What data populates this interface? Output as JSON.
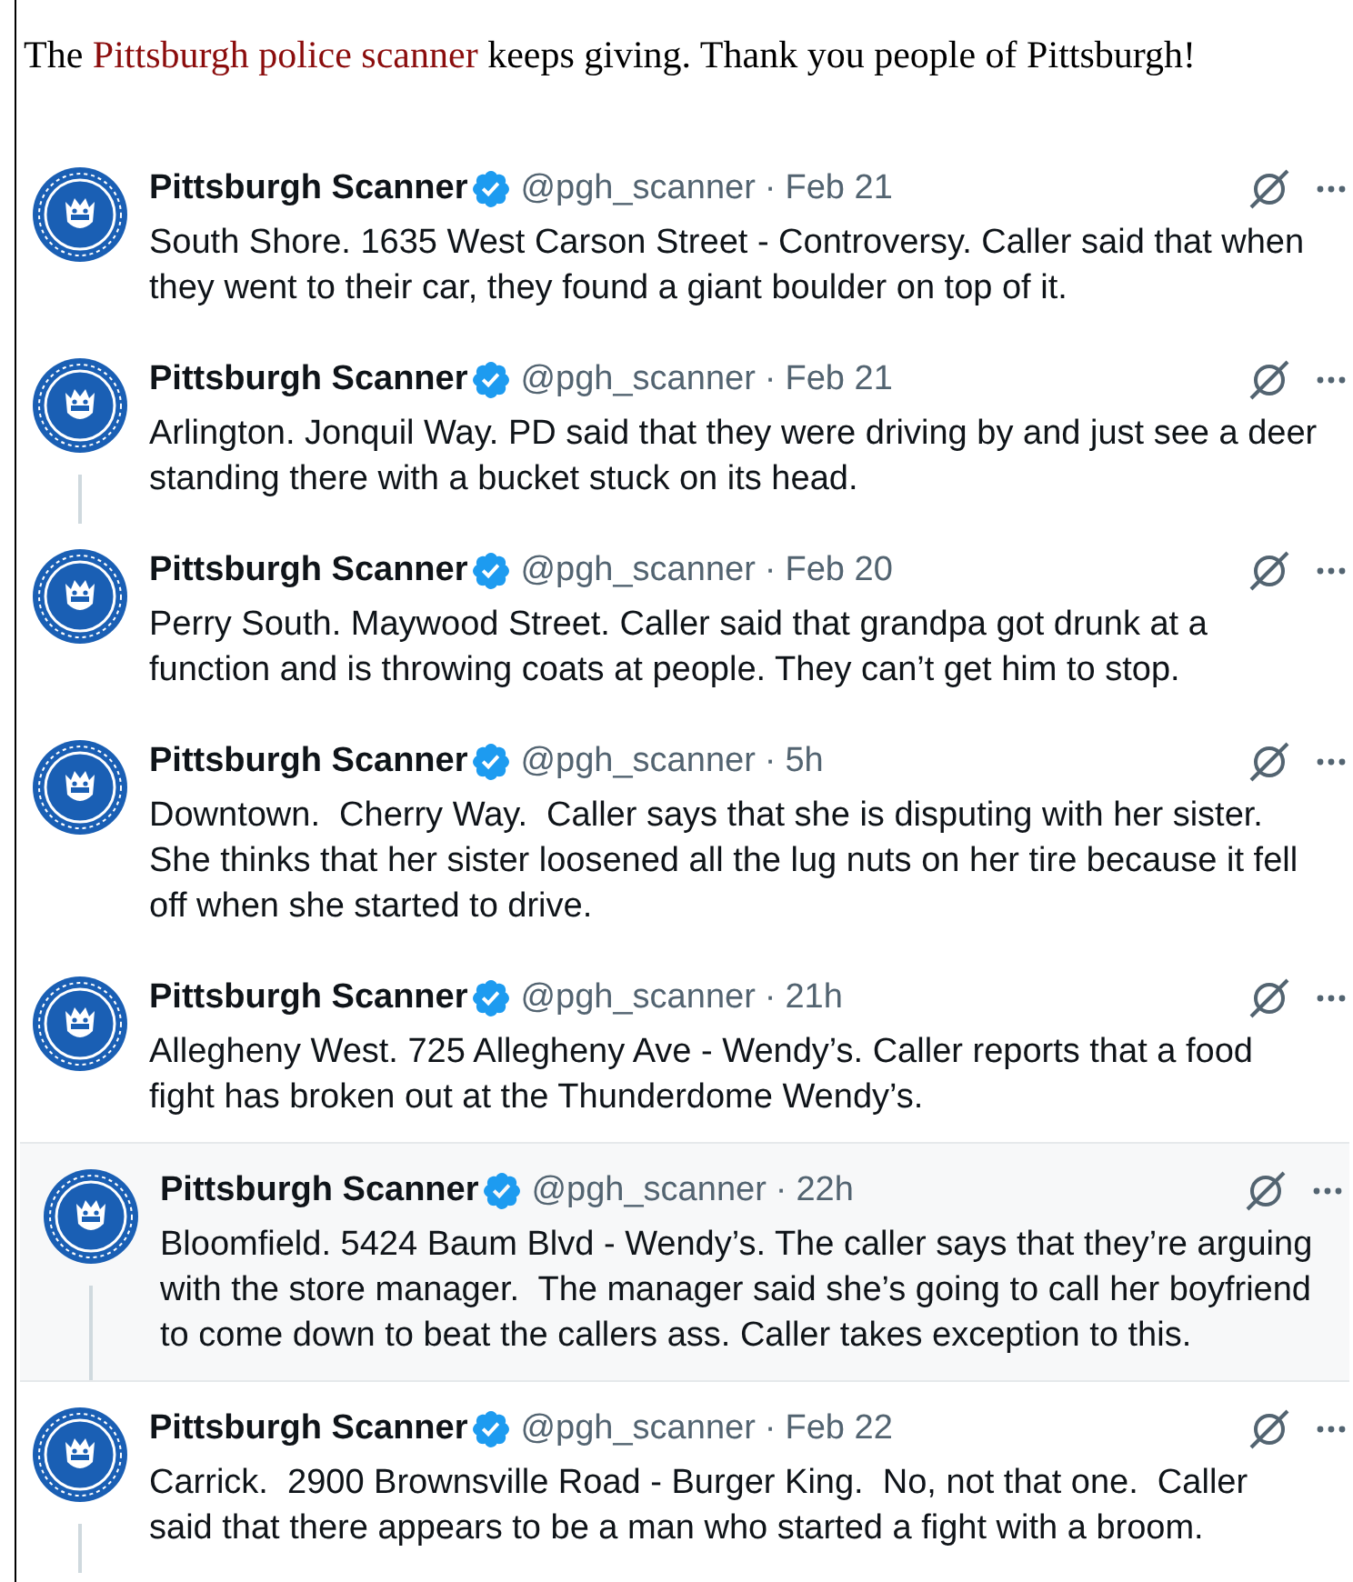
{
  "intro": {
    "text_before": "The ",
    "link": "Pittsburgh police scanner",
    "text_after": " keeps giving. Thank you people of Pittsburgh!"
  },
  "tweets": [
    {
      "name": "Pittsburgh Scanner",
      "verified": true,
      "handle": "@pgh_scanner",
      "separator": "·",
      "time": "Feb 21",
      "text": "South Shore. 1635 West Carson Street - Controversy. Caller said that when\nthey went to their car, they found a giant boulder on top of it.",
      "thread_line": false,
      "highlighted": false
    },
    {
      "name": "Pittsburgh Scanner",
      "verified": true,
      "handle": "@pgh_scanner",
      "separator": "·",
      "time": "Feb 21",
      "text": "Arlington. Jonquil Way. PD said that they were driving by and just see a deer\nstanding there with a bucket stuck on its head.",
      "thread_line": true,
      "highlighted": false
    },
    {
      "name": "Pittsburgh Scanner",
      "verified": true,
      "handle": "@pgh_scanner",
      "separator": "·",
      "time": "Feb 20",
      "text": "Perry South. Maywood Street. Caller said that grandpa got drunk at a\nfunction and is throwing coats at people. They can’t get him to stop.",
      "thread_line": false,
      "highlighted": false
    },
    {
      "name": "Pittsburgh Scanner",
      "verified": true,
      "handle": "@pgh_scanner",
      "separator": "·",
      "time": "5h",
      "text": "Downtown.  Cherry Way.  Caller says that she is disputing with her sister.\nShe thinks that her sister loosened all the lug nuts on her tire because it fell\noff when she started to drive.",
      "thread_line": false,
      "highlighted": false
    },
    {
      "name": "Pittsburgh Scanner",
      "verified": true,
      "handle": "@pgh_scanner",
      "separator": "·",
      "time": "21h",
      "text": "Allegheny West. 725 Allegheny Ave - Wendy’s. Caller reports that a food\nfight has broken out at the Thunderdome Wendy’s.",
      "thread_line": false,
      "highlighted": false
    },
    {
      "name": "Pittsburgh Scanner",
      "verified": true,
      "handle": "@pgh_scanner",
      "separator": "·",
      "time": "22h",
      "text": "Bloomfield. 5424 Baum Blvd - Wendy’s. The caller says that they’re arguing\nwith the store manager.  The manager said she’s going to call her boyfriend\nto come down to beat the callers ass. Caller takes exception to this.",
      "thread_line": true,
      "highlighted": true
    },
    {
      "name": "Pittsburgh Scanner",
      "verified": true,
      "handle": "@pgh_scanner",
      "separator": "·",
      "time": "Feb 22",
      "text": "Carrick.  2900 Brownsville Road - Burger King.  No, not that one.  Caller\nsaid that there appears to be a man who started a fight with a broom.",
      "thread_line": true,
      "highlighted": false
    }
  ]
}
